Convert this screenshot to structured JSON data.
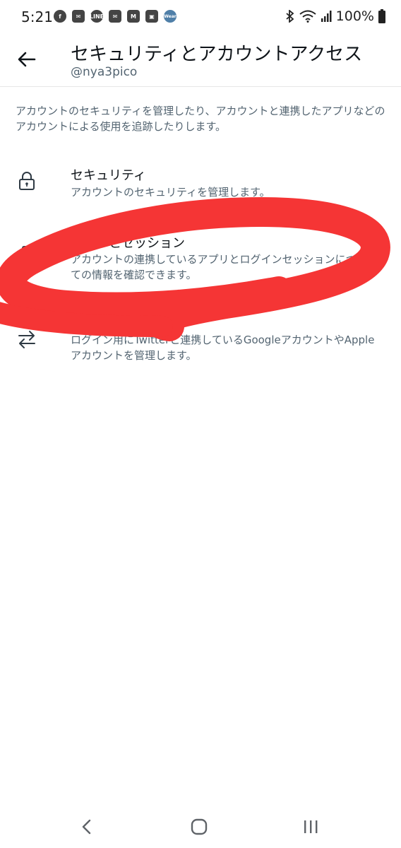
{
  "status_bar": {
    "time": "5:21",
    "battery": "100%",
    "notif_icons": [
      "facebook-icon",
      "mail-icon",
      "line-icon",
      "mail-icon",
      "gmail-icon",
      "gallery-icon",
      "wear-icon"
    ],
    "line_label": "LINE",
    "wear_label": "Wear"
  },
  "header": {
    "title": "セキュリティとアカウントアクセス",
    "subtitle": "@nya3pico"
  },
  "description": "アカウントのセキュリティを管理したり、アカウントと連携したアプリなどのアカウントによる使用を追跡したりします。",
  "items": [
    {
      "icon": "lock-icon",
      "title": "セキュリティ",
      "desc": "アカウントのセキュリティを管理します。"
    },
    {
      "icon": "copy-icon",
      "title": "アプリとセッション",
      "desc": "アカウントの連携しているアプリとログインセッションについての情報を確認できます。"
    },
    {
      "icon": "swap-icon",
      "title": "",
      "desc": "ログイン用にTwitterと連携しているGoogleアカウントやAppleアカウントを管理します。"
    }
  ],
  "annotation_color": "#f53535",
  "nav": [
    "back-nav-icon",
    "home-nav-icon",
    "recents-nav-icon"
  ]
}
